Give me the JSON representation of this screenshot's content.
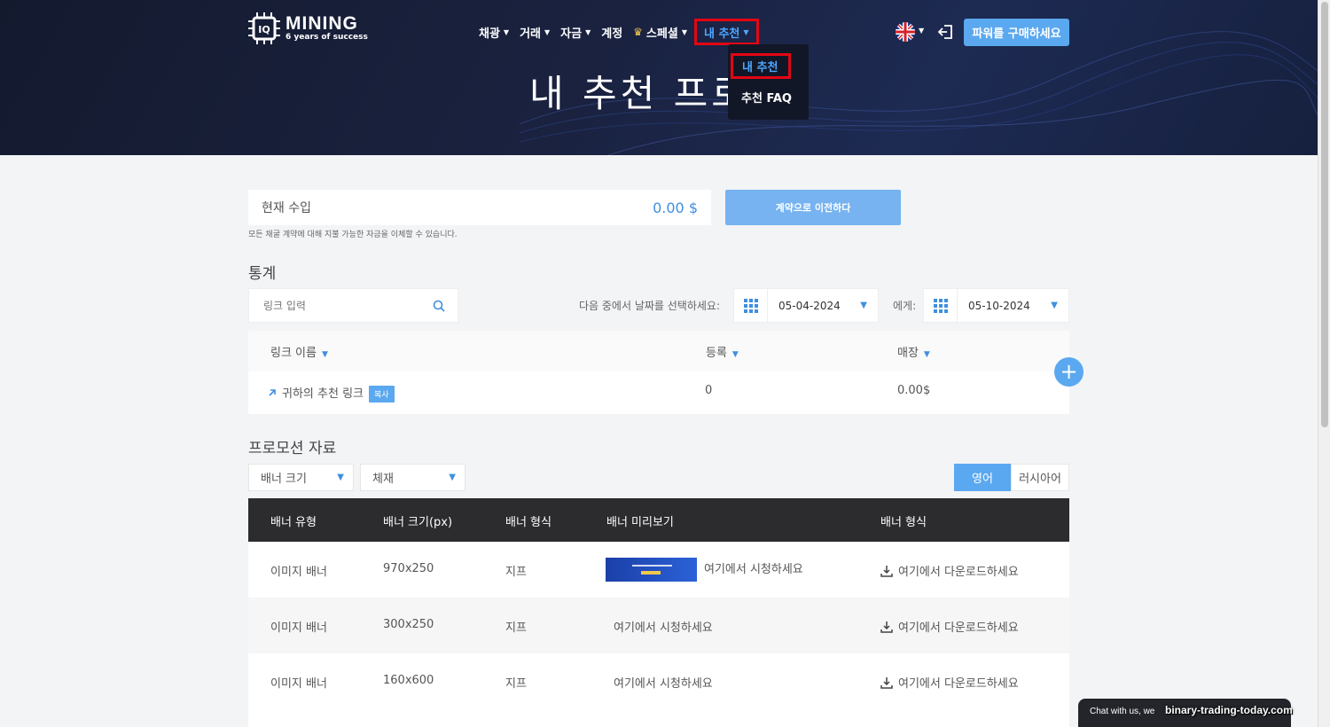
{
  "header": {
    "logo_name": "MINING",
    "logo_tagline": "6 years of success",
    "nav": [
      {
        "label": "채광"
      },
      {
        "label": "거래"
      },
      {
        "label": "자금"
      },
      {
        "label": "계정"
      },
      {
        "label": "스페셜"
      },
      {
        "label": "내 추천"
      }
    ],
    "dropdown": {
      "items": [
        "내 추천",
        "추천 FAQ"
      ]
    },
    "page_title": "내 추천 프로그램",
    "buy_button": "파워를 구매하세요",
    "accent_color": "#5aa8f0",
    "highlight_color": "#e30613"
  },
  "income": {
    "label": "현재 수입",
    "value": "0.00 $",
    "note": "모든 채굴 계약에 대해 지불 가능한 자금을 이체할 수 있습니다.",
    "transfer_button": "계약으로 이전하다"
  },
  "stats": {
    "title": "통계",
    "search_placeholder": "링크 입력",
    "date_label": "다음 중에서 날짜를 선택하세요:",
    "date_from": "05-04-2024",
    "date_to_label": "에게:",
    "date_to": "05-10-2024",
    "columns": [
      "링크 이름",
      "등록",
      "매장"
    ],
    "rows": [
      {
        "name": "귀하의 추천 링크",
        "copy": "복사",
        "registrations": "0",
        "sales": "0.00$"
      }
    ],
    "add_button": "+"
  },
  "promo": {
    "title": "프로모션 자료",
    "size_select": "배너 크기",
    "media_select": "체재",
    "lang_options": [
      "영어",
      "러시아어"
    ],
    "lang_selected": "영어",
    "columns": [
      "배너 유형",
      "배너 크기(px)",
      "배너 형식",
      "배너 미리보기",
      "배너 형식"
    ],
    "rows": [
      {
        "type": "이미지 배너",
        "size": "970x250",
        "format": "지프",
        "preview": "여기에서 시청하세요",
        "download": "여기에서 다운로드하세요",
        "has_thumb": true
      },
      {
        "type": "이미지 배너",
        "size": "300x250",
        "format": "지프",
        "preview": "여기에서 시청하세요",
        "download": "여기에서 다운로드하세요",
        "has_thumb": false
      },
      {
        "type": "이미지 배너",
        "size": "160x600",
        "format": "지프",
        "preview": "여기에서 시청하세요",
        "download": "여기에서 다운로드하세요",
        "has_thumb": false
      }
    ]
  },
  "chat": {
    "label": "Chat with us, we"
  },
  "watermark": "binary-trading-today.com"
}
